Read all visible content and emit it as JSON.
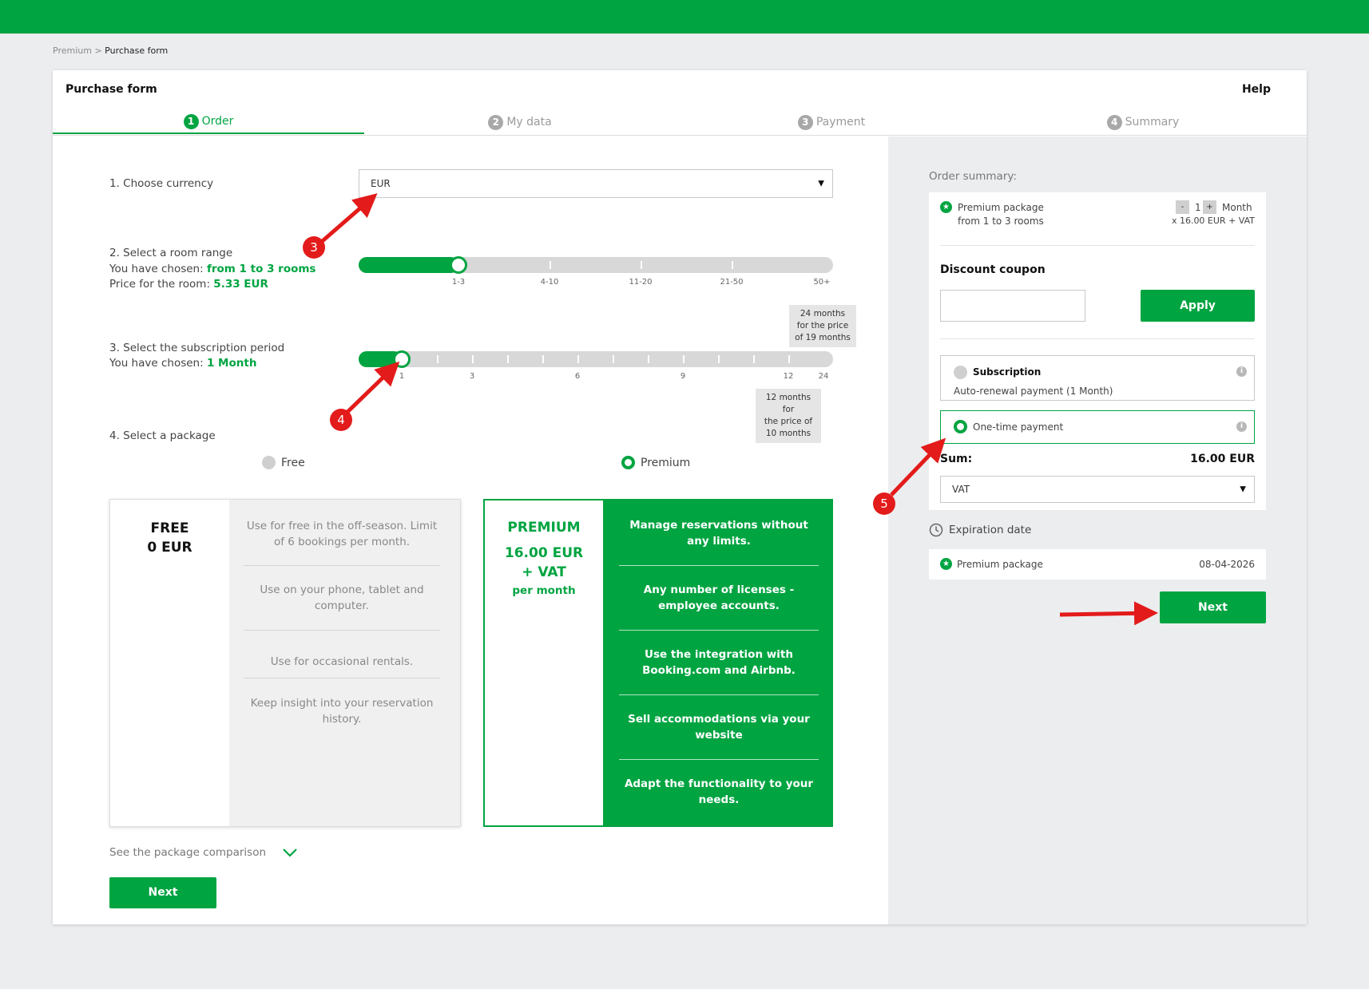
{
  "breadcrumb": {
    "root": "Premium",
    "sep": ">",
    "current": "Purchase form"
  },
  "header": {
    "title": "Purchase form",
    "help": "Help"
  },
  "steps": [
    {
      "num": "1",
      "label": "Order"
    },
    {
      "num": "2",
      "label": "My data"
    },
    {
      "num": "3",
      "label": "Payment"
    },
    {
      "num": "4",
      "label": "Summary"
    }
  ],
  "currency": {
    "label": "1. Choose currency",
    "value": "EUR"
  },
  "rooms": {
    "label": "2. Select a room range",
    "chosen_prefix": "You have chosen:",
    "chosen_value": "from 1 to 3 rooms",
    "price_prefix": "Price for the room:",
    "price_value": "5.33 EUR",
    "ticks": [
      "1-3",
      "4-10",
      "11-20",
      "21-50",
      "50+"
    ],
    "selected_index": 0
  },
  "period": {
    "label": "3. Select the subscription period",
    "chosen_prefix": "You have chosen:",
    "chosen_value": "1 Month",
    "ticks": [
      "1",
      "3",
      "6",
      "9",
      "12",
      "24"
    ],
    "tooltip_24": "24 months for the price of 19 months",
    "tooltip_24_lines": [
      "24 months",
      "for the price",
      "of 19 months"
    ],
    "tooltip_12_lines": [
      "12 months for",
      "the price of",
      "10 months"
    ]
  },
  "package": {
    "label": "4. Select a package",
    "free_label": "Free",
    "premium_label": "Premium",
    "selected": "Premium"
  },
  "free_pkg": {
    "name": "FREE",
    "price": "0 EUR",
    "features": [
      "Use for free in the off-season. Limit of 6 bookings per month.",
      "Use on your phone, tablet and computer.",
      "Use for occasional rentals.",
      "Keep insight into your reservation history."
    ]
  },
  "premium_pkg": {
    "name": "PREMIUM",
    "price": "16.00 EUR",
    "vat": "+ VAT",
    "per": "per month",
    "features": [
      "Manage reservations without any limits.",
      "Any number of licenses - employee accounts.",
      "Use the integration with Booking.com and Airbnb.",
      "Sell accommodations via your website",
      "Adapt the functionality to your needs."
    ]
  },
  "comparison_link": "See the package comparison",
  "next_label": "Next",
  "summary": {
    "title": "Order summary:",
    "package_name": "Premium package",
    "package_sub": "from 1 to 3 rooms",
    "qty_minus": "-",
    "qty_value": "1",
    "qty_plus": "+",
    "qty_unit": "Month",
    "unit_price": "x 16.00 EUR + VAT",
    "coupon_label": "Discount coupon",
    "coupon_placeholder": "",
    "apply_label": "Apply",
    "subscription_title": "Subscription",
    "subscription_sub": "Auto-renewal payment (1 Month)",
    "onetime_label": "One-time payment",
    "info_glyph": "i",
    "sum_label": "Sum:",
    "sum_value": "16.00 EUR",
    "vat_value": "VAT",
    "expiration_label": "Expiration date",
    "exp_package": "Premium package",
    "exp_date": "08-04-2026"
  },
  "annotations": [
    "3",
    "4",
    "5"
  ],
  "colors": {
    "brand": "#00a441",
    "arrow": "#e31b1b",
    "panel": "#ecedef"
  }
}
